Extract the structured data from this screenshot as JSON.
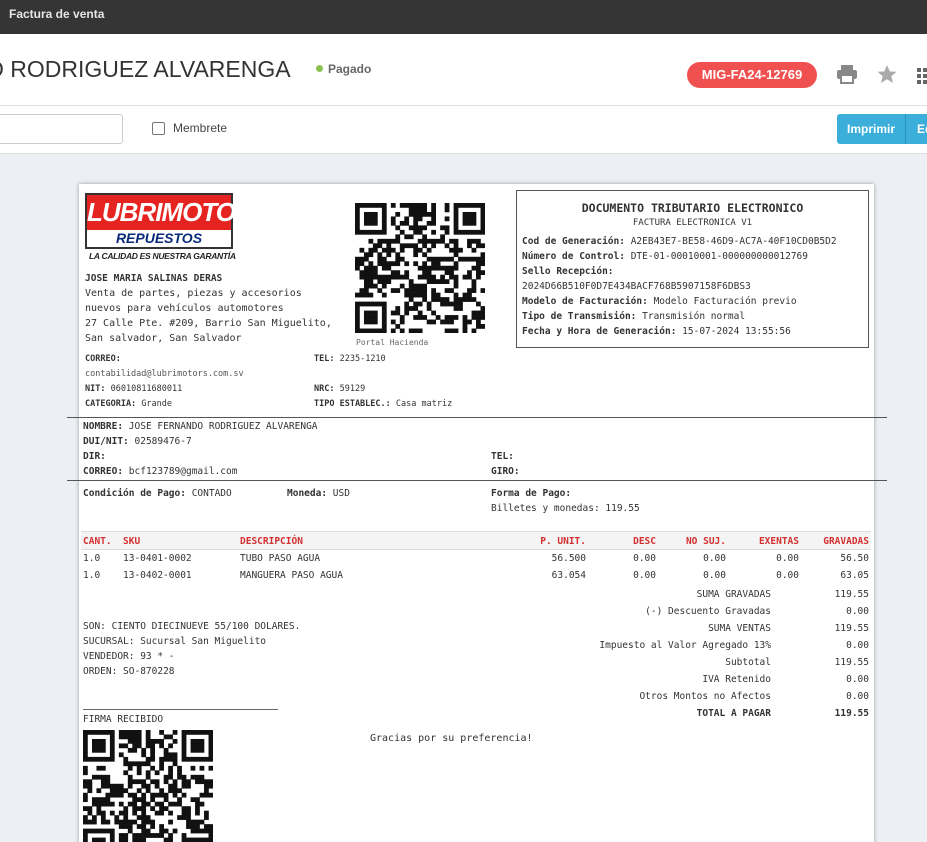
{
  "window": {
    "title": "Factura de venta"
  },
  "header": {
    "customer_name": "O RODRIGUEZ ALVARENGA",
    "status": "Pagado",
    "doc_number": "MIG-FA24-12769",
    "icons": [
      "printer-icon",
      "star-icon",
      "grid-icon"
    ],
    "colors": {
      "status": "#8cc152",
      "badge": "#f0504f"
    }
  },
  "toolbar": {
    "search_value": "",
    "letterhead_label": "Membrete",
    "print_label": "Imprimir",
    "edit_label": "Ed",
    "colors": {
      "primary": "#3bafda"
    }
  },
  "invoice": {
    "logo": {
      "brand": "LUBRIMOTORS",
      "sub": "REPUESTOS",
      "tagline": "LA CALIDAD ES NUESTRA GARANTÍA"
    },
    "issuer": {
      "name": "JOSE MARIA SALINAS DERAS",
      "line1": "Venta de partes, piezas y accesorios",
      "line2": "nuevos para vehículos automotores",
      "line3": "27 Calle Pte. #209, Barrio San Miguelito,",
      "line4": "San salvador, San Salvador"
    },
    "portal_label": "Portal Hacienda",
    "contact": {
      "correo_label": "CORREO:",
      "correo": "contabilidad@lubrimotors.com.sv",
      "tel_label": "TEL:",
      "tel": "2235-1210",
      "nit_label": "NIT:",
      "nit": "06010811680011",
      "nrc_label": "NRC:",
      "nrc": "59129",
      "categoria_label": "CATEGORIA:",
      "categoria": "Grande",
      "tipo_label": "TIPO ESTABLEC.:",
      "tipo": "Casa matriz"
    },
    "dte": {
      "title": "DOCUMENTO TRIBUTARIO ELECTRONICO",
      "subtitle": "FACTURA ELECTRONICA V1",
      "cod_label": "Cod de Generación:",
      "cod": "A2EB43E7-BE58-46D9-AC7A-40F10CD0B5D2",
      "control_label": "Número de Control:",
      "control": "DTE-01-00010001-000000000012769",
      "sello_label": "Sello Recepción:",
      "sello": "2024D66B510F0D7E434BACF768B5907158F6DBS3",
      "modelo_label": "Modelo de Facturación:",
      "modelo": "Modelo Facturación previo",
      "transmision_label": "Tipo de Transmisión:",
      "transmision": "Transmisión normal",
      "fecha_label": "Fecha y Hora de Generación:",
      "fecha": "15-07-2024 13:55:56"
    },
    "client": {
      "nombre_label": "NOMBRE:",
      "nombre": "JOSE FERNANDO RODRIGUEZ ALVARENGA",
      "dui_label": "DUI/NIT:",
      "dui": "02589476-7",
      "dir_label": "DIR:",
      "dir": "",
      "correo_label": "CORREO:",
      "correo": "bcf123789@gmail.com",
      "tel_label": "TEL:",
      "tel": "",
      "giro_label": "GIRO:",
      "giro": ""
    },
    "payment": {
      "condicion_label": "Condición de Pago:",
      "condicion": "CONTADO",
      "moneda_label": "Moneda:",
      "moneda": "USD",
      "forma_label": "Forma de Pago:",
      "forma": "Billetes y monedas: 119.55"
    },
    "columns": [
      "CANT.",
      "SKU",
      "DESCRIPCIÓN",
      "P. UNIT.",
      "DESC",
      "NO SUJ.",
      "EXENTAS",
      "GRAVADAS"
    ],
    "items": [
      {
        "cant": "1.0",
        "sku": "13-0401-0002",
        "desc": "TUBO PASO AGUA",
        "punit": "56.500",
        "descuento": "0.00",
        "nosuj": "0.00",
        "exentas": "0.00",
        "gravadas": "56.50"
      },
      {
        "cant": "1.0",
        "sku": "13-0402-0001",
        "desc": "MANGUERA PASO AGUA",
        "punit": "63.054",
        "descuento": "0.00",
        "nosuj": "0.00",
        "exentas": "0.00",
        "gravadas": "63.05"
      }
    ],
    "totals": [
      {
        "label": "SUMA GRAVADAS",
        "value": "119.55"
      },
      {
        "label": "(-) Descuento Gravadas",
        "value": "0.00"
      },
      {
        "label": "SUMA VENTAS",
        "value": "119.55"
      },
      {
        "label": "Impuesto al Valor Agregado 13%",
        "value": "0.00"
      },
      {
        "label": "Subtotal",
        "value": "119.55"
      },
      {
        "label": "IVA Retenido",
        "value": "0.00"
      },
      {
        "label": "Otros Montos no Afectos",
        "value": "0.00"
      },
      {
        "label": "TOTAL A PAGAR",
        "value": "119.55"
      }
    ],
    "son": "SON: CIENTO DIECINUEVE 55/100 DOLARES.",
    "sucursal": "SUCURSAL: Sucursal San Miguelito",
    "vendedor": "VENDEDOR: 93 * -",
    "orden": "ORDEN: SO-870228",
    "firma": "FIRMA RECIBIDO",
    "thanks": "Gracias por su preferencia!"
  }
}
